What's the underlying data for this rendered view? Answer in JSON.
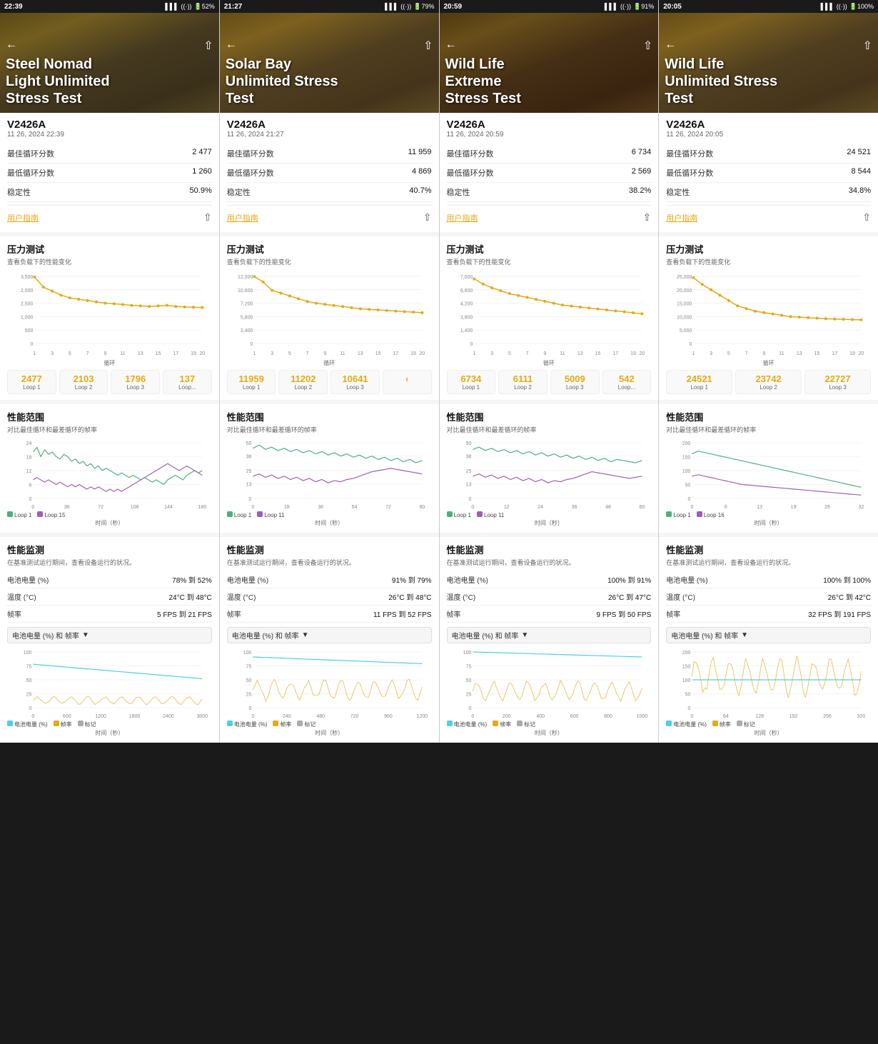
{
  "panels": [
    {
      "id": "panel1",
      "statusBar": {
        "time": "22:39",
        "battery": "52%"
      },
      "headerTitle": "Steel Nomad\nLight Unlimited\nStress Test",
      "headerBg": "linear-gradient(135deg, #7a6010 0%, #b08020 40%, #5a4010 100%)",
      "deviceName": "V2426A",
      "deviceDate": "11 26, 2024 22:39",
      "stats": [
        {
          "label": "最佳循环分数",
          "value": "2 477"
        },
        {
          "label": "最低循环分数",
          "value": "1 260"
        },
        {
          "label": "稳定性",
          "value": "50.9%"
        }
      ],
      "pressureTitle": "压力测试",
      "pressureSubtitle": "查看负载下的性能变化",
      "chartYMax": 2500,
      "chartData": [
        2477,
        2100,
        1950,
        1800,
        1700,
        1650,
        1600,
        1550,
        1500,
        1480,
        1450,
        1420,
        1400,
        1380,
        1400,
        1420,
        1380,
        1360,
        1350,
        1340
      ],
      "loopValues": [
        {
          "num": "2477",
          "label": "Loop 1"
        },
        {
          "num": "2103",
          "label": "Loop 2"
        },
        {
          "num": "1796",
          "label": "Loop 3"
        },
        {
          "num": "137",
          "label": "Loop..."
        }
      ],
      "rangeTitle": "性能范围",
      "rangeSubtitle": "对比最佳循环和最差循环的帧率",
      "rangeYMax": 24,
      "rangeLoop1": [
        20,
        22,
        18,
        21,
        19,
        20,
        18,
        17,
        19,
        18,
        16,
        17,
        15,
        16,
        14,
        15,
        13,
        14,
        12,
        13,
        12,
        11,
        10,
        11,
        10,
        9,
        10,
        9,
        8,
        9,
        8,
        7,
        8,
        7,
        6,
        8,
        9,
        10,
        9,
        8,
        10,
        11,
        12,
        11,
        12
      ],
      "rangeLoop2": [
        8,
        9,
        8,
        7,
        8,
        7,
        6,
        7,
        6,
        5,
        6,
        5,
        6,
        5,
        4,
        5,
        4,
        5,
        4,
        3,
        4,
        3,
        4,
        3,
        4,
        5,
        6,
        7,
        8,
        9,
        10,
        11,
        12,
        13,
        14,
        15,
        14,
        13,
        12,
        13,
        14,
        13,
        12,
        11,
        10
      ],
      "rangeXMax": 180,
      "rangeLegend1": "Loop 1",
      "rangeLegend2": "Loop 15",
      "rangeXLabel": "时间（秒）",
      "monitorTitle": "性能监测",
      "monitorSubtitle": "在基准测试运行期间，查看设备运行的状况。",
      "monitorRows": [
        {
          "label": "电池电量 (%)",
          "value": "78% 到 52%"
        },
        {
          "label": "温度 (°C)",
          "value": "24°C 到 48°C"
        },
        {
          "label": "帧率",
          "value": "5 FPS 到 21 FPS"
        }
      ],
      "batteryDropdown": "电池电量 (%) 和 帧率",
      "batteryYMax": 100,
      "batteryXMax": 3000,
      "batteryLegend": [
        "电池电量 (%)",
        "帧率",
        "标记"
      ]
    },
    {
      "id": "panel2",
      "statusBar": {
        "time": "21:27",
        "battery": "79%"
      },
      "headerTitle": "Solar Bay\nUnlimited Stress\nTest",
      "headerBg": "linear-gradient(135deg, #8b6914 0%, #c4982b 30%, #6b5020 100%)",
      "deviceName": "V2426A",
      "deviceDate": "11 26, 2024 21:27",
      "stats": [
        {
          "label": "最佳循环分数",
          "value": "11 959"
        },
        {
          "label": "最低循环分数",
          "value": "4 869"
        },
        {
          "label": "稳定性",
          "value": "40.7%"
        }
      ],
      "pressureTitle": "压力测试",
      "pressureSubtitle": "查看负载下的性能变化",
      "chartYMax": 12000,
      "chartData": [
        11959,
        11000,
        9500,
        9000,
        8500,
        8000,
        7500,
        7200,
        7000,
        6800,
        6600,
        6400,
        6200,
        6100,
        6000,
        5900,
        5800,
        5700,
        5600,
        5500
      ],
      "loopValues": [
        {
          "num": "11959",
          "label": "Loop 1"
        },
        {
          "num": "11202",
          "label": "Loop 2"
        },
        {
          "num": "10641",
          "label": "Loop 3"
        },
        {
          "num": "‹",
          "label": ""
        }
      ],
      "rangeTitle": "性能范围",
      "rangeSubtitle": "对比最佳循环和最差循环的帧率",
      "rangeYMax": 50,
      "rangeLoop1": [
        45,
        48,
        44,
        46,
        43,
        45,
        42,
        44,
        41,
        43,
        40,
        42,
        39,
        41,
        38,
        40,
        37,
        39,
        36,
        38,
        35,
        37,
        34,
        36,
        33,
        35,
        32,
        34
      ],
      "rangeLoop2": [
        20,
        22,
        19,
        21,
        18,
        20,
        17,
        19,
        16,
        18,
        15,
        17,
        14,
        16,
        15,
        17,
        18,
        20,
        22,
        24,
        25,
        26,
        27,
        26,
        25,
        24,
        23,
        22
      ],
      "rangeXMax": 90,
      "rangeLegend1": "Loop 1",
      "rangeLegend2": "Loop 11",
      "rangeXLabel": "时间（秒）",
      "monitorTitle": "性能监测",
      "monitorSubtitle": "在基准测试运行期间，查看设备运行的状况。",
      "monitorRows": [
        {
          "label": "电池电量 (%)",
          "value": "91% 到 79%"
        },
        {
          "label": "温度 (°C)",
          "value": "26°C 到 48°C"
        },
        {
          "label": "帧率",
          "value": "11 FPS 到 52 FPS"
        }
      ],
      "batteryDropdown": "电池电量 (%) 和 帧率",
      "batteryYMax": 100,
      "batteryXMax": 1200,
      "batteryLegend": [
        "电池电量 (%)",
        "帧率",
        "标记"
      ]
    },
    {
      "id": "panel3",
      "statusBar": {
        "time": "20:59",
        "battery": "91%"
      },
      "headerTitle": "Wild Life\nExtreme\nStress Test",
      "headerBg": "linear-gradient(135deg, #6b4010 0%, #a06820 30%, #5a3010 100%)",
      "deviceName": "V2426A",
      "deviceDate": "11 26, 2024 20:59",
      "stats": [
        {
          "label": "最佳循环分数",
          "value": "6 734"
        },
        {
          "label": "最低循环分数",
          "value": "2 569"
        },
        {
          "label": "稳定性",
          "value": "38.2%"
        }
      ],
      "pressureTitle": "压力测试",
      "pressureSubtitle": "查看负载下的性能变化",
      "chartYMax": 7000,
      "chartData": [
        6734,
        6200,
        5800,
        5500,
        5200,
        5000,
        4800,
        4600,
        4400,
        4200,
        4000,
        3900,
        3800,
        3700,
        3600,
        3500,
        3400,
        3300,
        3200,
        3100
      ],
      "loopValues": [
        {
          "num": "6734",
          "label": "Loop 1"
        },
        {
          "num": "6111",
          "label": "Loop 2"
        },
        {
          "num": "5009",
          "label": "Loop 3"
        },
        {
          "num": "542",
          "label": "Loop..."
        }
      ],
      "rangeTitle": "性能范围",
      "rangeSubtitle": "对比最佳循环和最差循环的帧率",
      "rangeYMax": 50,
      "rangeLoop1": [
        44,
        46,
        43,
        45,
        42,
        44,
        41,
        43,
        40,
        42,
        39,
        41,
        38,
        40,
        37,
        39,
        36,
        38,
        35,
        37,
        34,
        36,
        33,
        35,
        34,
        33,
        32,
        34
      ],
      "rangeLoop2": [
        20,
        22,
        19,
        21,
        18,
        20,
        17,
        19,
        16,
        18,
        15,
        17,
        14,
        16,
        15,
        17,
        18,
        20,
        22,
        24,
        23,
        22,
        21,
        20,
        19,
        18,
        19,
        20
      ],
      "rangeXMax": 60,
      "rangeLegend1": "Loop 1",
      "rangeLegend2": "Loop 11",
      "rangeXLabel": "时间（秒）",
      "monitorTitle": "性能监测",
      "monitorSubtitle": "在基准测试运行期间，查看设备运行的状况。",
      "monitorRows": [
        {
          "label": "电池电量 (%)",
          "value": "100% 到 91%"
        },
        {
          "label": "温度 (°C)",
          "value": "26°C 到 47°C"
        },
        {
          "label": "帧率",
          "value": "9 FPS 到 50 FPS"
        }
      ],
      "batteryDropdown": "电池电量 (%) 和 帧率",
      "batteryYMax": 100,
      "batteryXMax": 1000,
      "batteryLegend": [
        "电池电量 (%)",
        "帧率",
        "标记"
      ]
    },
    {
      "id": "panel4",
      "statusBar": {
        "time": "20:05",
        "battery": "100%"
      },
      "headerTitle": "Wild Life\nUnlimited Stress\nTest",
      "headerBg": "linear-gradient(135deg, #8b6914 0%, #c4982b 30%, #6b5020 100%)",
      "deviceName": "V2426A",
      "deviceDate": "11 26, 2024 20:05",
      "stats": [
        {
          "label": "最佳循环分数",
          "value": "24 521"
        },
        {
          "label": "最低循环分数",
          "value": "8 544"
        },
        {
          "label": "稳定性",
          "value": "34.8%"
        }
      ],
      "pressureTitle": "压力测试",
      "pressureSubtitle": "查看负载下的性能变化",
      "chartYMax": 25000,
      "chartData": [
        24521,
        22000,
        20000,
        18000,
        16000,
        14000,
        13000,
        12000,
        11500,
        11000,
        10500,
        10000,
        9800,
        9600,
        9400,
        9200,
        9100,
        9000,
        8900,
        8800
      ],
      "loopValues": [
        {
          "num": "24521",
          "label": "Loop 1"
        },
        {
          "num": "23742",
          "label": "Loop 2"
        },
        {
          "num": "22727",
          "label": "Loop 3"
        }
      ],
      "rangeTitle": "性能范围",
      "rangeSubtitle": "对比最佳循环和最差循环的帧率",
      "rangeYMax": 200,
      "rangeLoop1": [
        160,
        170,
        165,
        160,
        155,
        150,
        145,
        140,
        135,
        130,
        125,
        120,
        115,
        110,
        105,
        100,
        95,
        90,
        85,
        80,
        75,
        70,
        65,
        60,
        55,
        50,
        45,
        40
      ],
      "rangeLoop2": [
        80,
        85,
        80,
        75,
        70,
        65,
        60,
        55,
        50,
        48,
        46,
        44,
        42,
        40,
        38,
        36,
        34,
        32,
        30,
        28,
        26,
        24,
        22,
        20,
        18,
        16,
        14,
        12
      ],
      "rangeXMax": 32,
      "rangeLegend1": "Loop 1",
      "rangeLegend2": "Loop 16",
      "rangeXLabel": "时间（秒）",
      "monitorTitle": "性能监测",
      "monitorSubtitle": "在基准测试运行期间，查看设备运行的状况。",
      "monitorRows": [
        {
          "label": "电池电量 (%)",
          "value": "100% 到 100%"
        },
        {
          "label": "温度 (°C)",
          "value": "26°C 到 42°C"
        },
        {
          "label": "帧率",
          "value": "32 FPS 到 191 FPS"
        }
      ],
      "batteryDropdown": "电池电量 (%) 和 帧率",
      "batteryYMax": 200,
      "batteryXMax": 320,
      "batteryLegend": [
        "电池电量 (%)",
        "帧率",
        "标记"
      ]
    }
  ],
  "userGuideLabel": "用户指南",
  "shareLabel": "⇧"
}
